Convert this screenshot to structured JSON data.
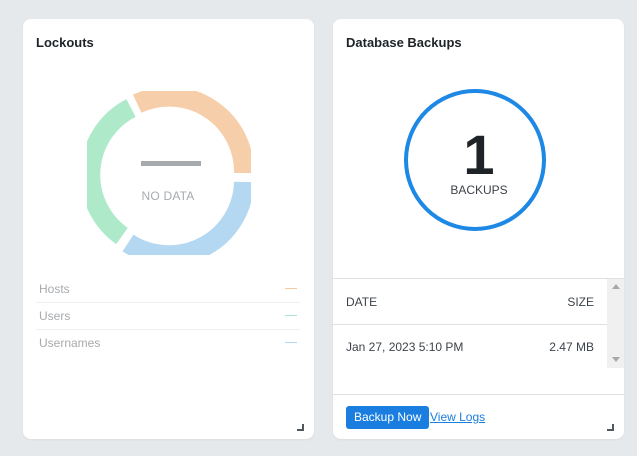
{
  "lockouts": {
    "title": "Lockouts",
    "no_data_label": "NO DATA",
    "legend": [
      {
        "label": "Hosts",
        "color": "#f4c9a0"
      },
      {
        "label": "Users",
        "color": "#abe8c8"
      },
      {
        "label": "Usernames",
        "color": "#b3d7f0"
      }
    ],
    "colors": {
      "orange": "#f6ceaa",
      "green": "#aeeac9",
      "blue": "#b4d8f1"
    }
  },
  "backups": {
    "title": "Database Backups",
    "count": "1",
    "count_label": "BACKUPS",
    "table": {
      "headers": {
        "date": "DATE",
        "size": "SIZE"
      },
      "rows": [
        {
          "date": "Jan 27, 2023 5:10 PM",
          "size": "2.47 MB"
        }
      ]
    },
    "backup_button": "Backup Now",
    "view_logs_link": "View Logs",
    "accent": "#1e88e5"
  }
}
